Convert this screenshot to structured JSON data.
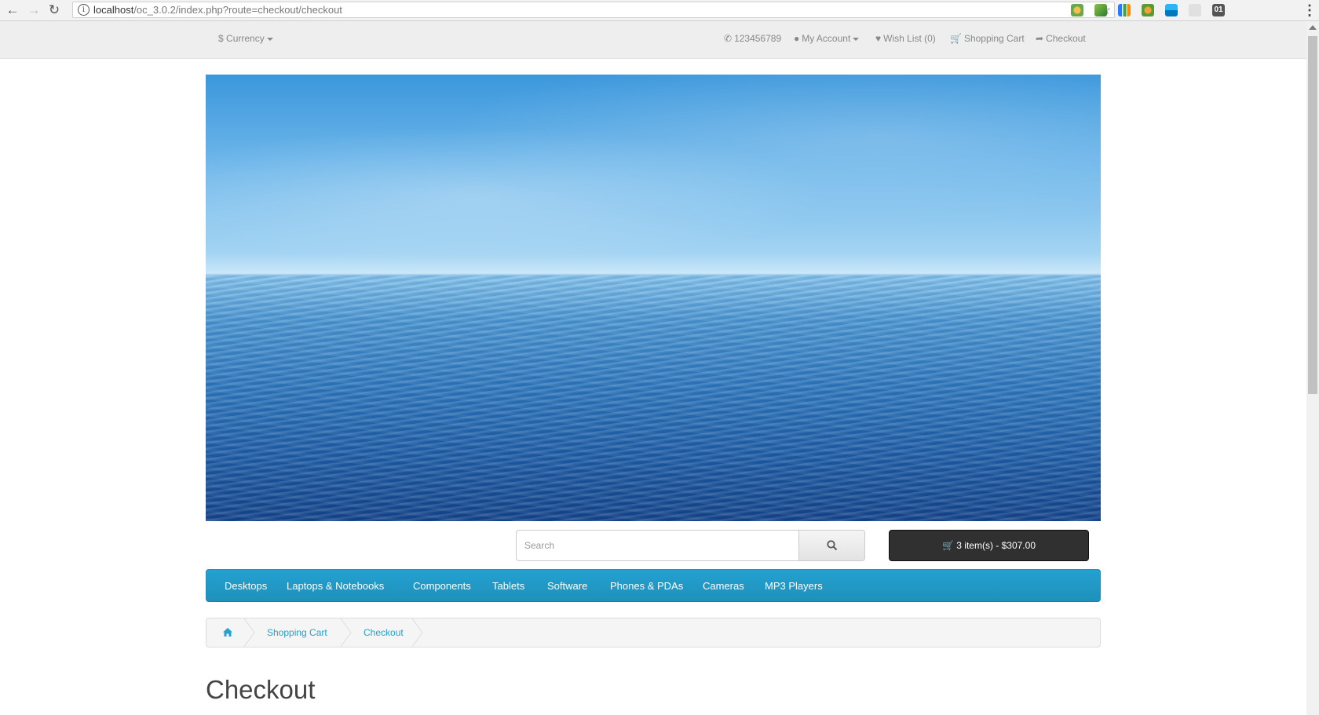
{
  "browser": {
    "url_host": "localhost",
    "url_path": "/oc_3.0.2/index.php?route=checkout/checkout"
  },
  "topbar": {
    "currency_label": "Currency",
    "currency_symbol": "$",
    "phone": "123456789",
    "my_account": "My Account",
    "wish_list": "Wish List (0)",
    "shopping_cart": "Shopping Cart",
    "checkout": "Checkout"
  },
  "search": {
    "placeholder": "Search"
  },
  "cart": {
    "label": "3 item(s) - $307.00"
  },
  "menu": {
    "items": [
      "Desktops",
      "Laptops & Notebooks",
      "Components",
      "Tablets",
      "Software",
      "Phones & PDAs",
      "Cameras",
      "MP3 Players"
    ]
  },
  "breadcrumb": {
    "items": [
      "Shopping Cart",
      "Checkout"
    ]
  },
  "page": {
    "title": "Checkout"
  },
  "colors": {
    "accent": "#229ac8",
    "cart_button": "#303030",
    "topbar": "#eeeeee"
  }
}
